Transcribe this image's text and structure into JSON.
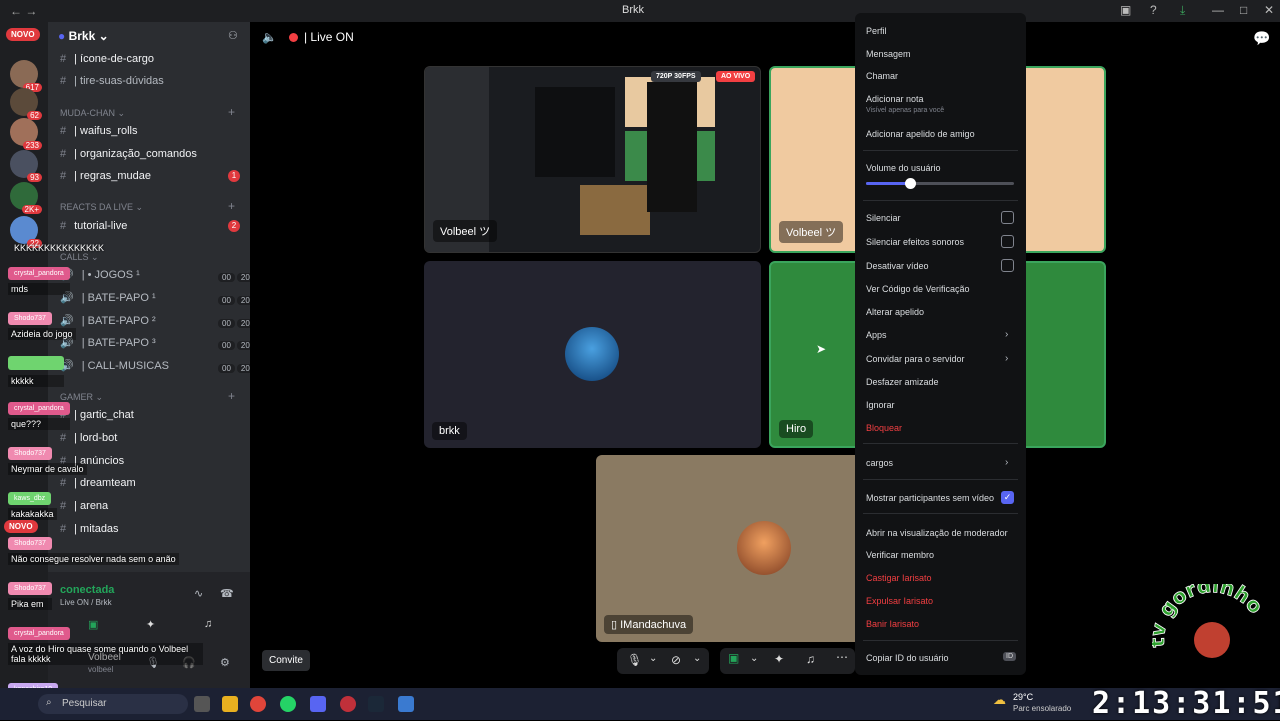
{
  "window": {
    "title": "Brkk",
    "nav": "← →"
  },
  "servers": {
    "new_badge": "NOVO",
    "badges": [
      "617",
      "62",
      "233",
      "93",
      "2K+",
      "22"
    ]
  },
  "sidebar": {
    "guild_name": "Brkk",
    "channels_top": [
      {
        "label": "| ícone-de-cargo",
        "bright": true
      },
      {
        "label": "| tire-suas-dúvidas",
        "bright": false
      }
    ],
    "cat_muda": "MUDA-CHAN",
    "muda": [
      {
        "label": "| waifus_rolls",
        "badge": ""
      },
      {
        "label": "| organização_comandos",
        "badge": ""
      },
      {
        "label": "| regras_mudae",
        "badge": "1"
      }
    ],
    "cat_reacts": "REACTS DA LIVE",
    "reacts": [
      {
        "label": "tutorial-live",
        "badge": "2"
      }
    ],
    "cat_calls": "CALLS",
    "calls": [
      {
        "label": "| • JOGOS ¹",
        "counts": [
          "00",
          "20"
        ]
      },
      {
        "label": "| BATE-PAPO ¹",
        "counts": [
          "00",
          "20"
        ]
      },
      {
        "label": "| BATE-PAPO ²",
        "counts": [
          "00",
          "20"
        ]
      },
      {
        "label": "| BATE-PAPO ³",
        "counts": [
          "00",
          "20"
        ]
      },
      {
        "label": "| CALL-MUSICAS",
        "counts": [
          "00",
          "20"
        ]
      }
    ],
    "cat_gamer": "GAMER",
    "gamer": [
      {
        "label": "| gartic_chat"
      },
      {
        "label": "| lord-bot"
      },
      {
        "label": "| anúncios"
      },
      {
        "label": "| dreamteam"
      },
      {
        "label": "| arena"
      },
      {
        "label": "| mitadas"
      }
    ],
    "voice_status": "conectada",
    "voice_channel": "Live ON / Brkk",
    "user_name": "Volbeel",
    "user_tag": "volbeel",
    "novo2": "NOVO"
  },
  "stage": {
    "header": "| Live ON",
    "tiles": [
      {
        "name": "Volbeel ツ",
        "stream_quality": "720P 30FPS",
        "live": "AO VIVO"
      },
      {
        "name": "Volbeel ツ"
      },
      {
        "name": "brkk"
      },
      {
        "name": "Hiro"
      },
      {
        "name": "IMandachuva"
      }
    ],
    "invite_label": "Convite"
  },
  "context_menu": {
    "items": [
      "Perfil",
      "Mensagem",
      "Chamar",
      "Adicionar nota",
      "Adicionar apelido de amigo"
    ],
    "note_sub": "Visível apenas para você",
    "volume_label": "Volume do usuário",
    "volume_level": 0.3,
    "toggles": [
      {
        "label": "Silenciar",
        "checked": false
      },
      {
        "label": "Silenciar efeitos sonoros",
        "checked": false
      },
      {
        "label": "Desativar vídeo",
        "checked": false
      }
    ],
    "mid": [
      "Ver Código de Verificação",
      "Alterar apelido",
      "Apps",
      "Convidar para o servidor",
      "Desfazer amizade",
      "Ignorar",
      "Bloquear"
    ],
    "cargos": "cargos",
    "show_participants": "Mostrar participantes sem vídeo",
    "mod": [
      "Abrir na visualização de moderador",
      "Verificar membro",
      "Castigar Iarisato",
      "Expulsar Iarisato",
      "Banir Iarisato"
    ],
    "copy_id": "Copiar ID do usuário",
    "id_badge": "ID"
  },
  "chat_overlay": [
    {
      "user": "",
      "text": "KKKKKKKKKKKKKKK",
      "color": "#e05a8c"
    },
    {
      "user": "crystal_pandora",
      "text": "mds",
      "color": "#e05a8c"
    },
    {
      "user": "Shodo737",
      "text": "Azideia do jogo",
      "color": "#f08ab0"
    },
    {
      "user": "",
      "text": "kkkkk",
      "color": "#6fd46f"
    },
    {
      "user": "crystal_pandora",
      "text": "que???",
      "color": "#e05a8c"
    },
    {
      "user": "Shodo737",
      "text": "Neymar de cavalo",
      "color": "#f08ab0"
    },
    {
      "user": "kaws_dbz",
      "text": "kakakakka",
      "color": "#6fd46f"
    },
    {
      "user": "Shodo737",
      "text": "Não consegue resolver nada sem o anão",
      "color": "#f08ab0"
    },
    {
      "user": "Shodo737",
      "text": "Pika em",
      "color": "#f08ab0"
    },
    {
      "user": "crystal_pandora",
      "text": "A voz do Hiro quase some quando o Volbeel fala kkkkk",
      "color": "#e05a8c"
    },
    {
      "user": "kanashiro10",
      "text": "ué",
      "color": "#c8a8f0"
    }
  ],
  "taskbar": {
    "search_placeholder": "Pesquisar",
    "weather_temp": "29°C",
    "weather_desc": "Parc ensolarado"
  },
  "overlay_clock": "2:13:31:51",
  "watermark": "tv gordinho"
}
